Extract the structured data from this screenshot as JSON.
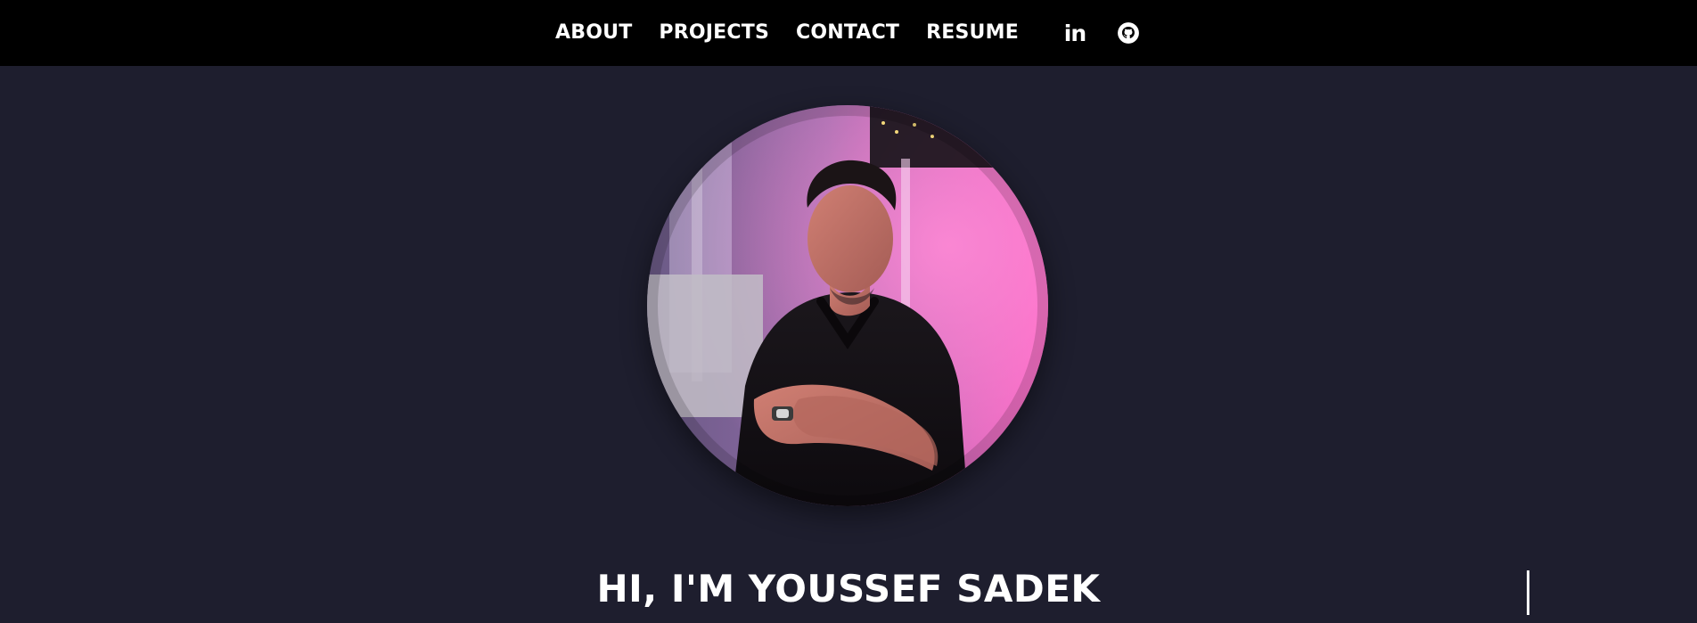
{
  "nav": {
    "items": [
      {
        "label": "ABOUT"
      },
      {
        "label": "PROJECTS"
      },
      {
        "label": "CONTACT"
      },
      {
        "label": "RESUME"
      }
    ],
    "linkedin_text": "in",
    "icons": [
      "linkedin-icon",
      "github-icon"
    ]
  },
  "hero": {
    "title": "HI, I'M YOUSSEF SADEK",
    "avatar_icon": "profile-photo"
  },
  "colors": {
    "topbar_bg": "#000000",
    "page_bg": "#1e1e2e",
    "text": "#ffffff",
    "photo_pink": "#ff66c4"
  }
}
